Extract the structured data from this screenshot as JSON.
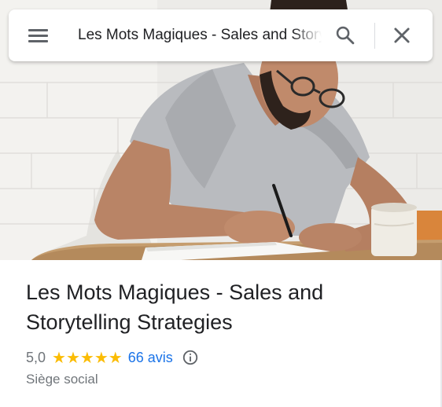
{
  "search": {
    "query": "Les Mots Magiques - Sales and Storytelling Strategies",
    "menu_icon": "menu-icon",
    "search_icon": "search-icon",
    "close_icon": "close-icon"
  },
  "place": {
    "name": "Les Mots Magiques - Sales and Storytelling Strategies",
    "rating": "5,0",
    "stars": "★★★★★",
    "rating_fraction": 1.0,
    "reviews_label": "66 avis",
    "category": "Siège social",
    "info_icon": "info-icon"
  },
  "colors": {
    "star": "#fbbc04",
    "link": "#1a73e8",
    "secondary_text": "#70757a",
    "title_text": "#202124"
  }
}
